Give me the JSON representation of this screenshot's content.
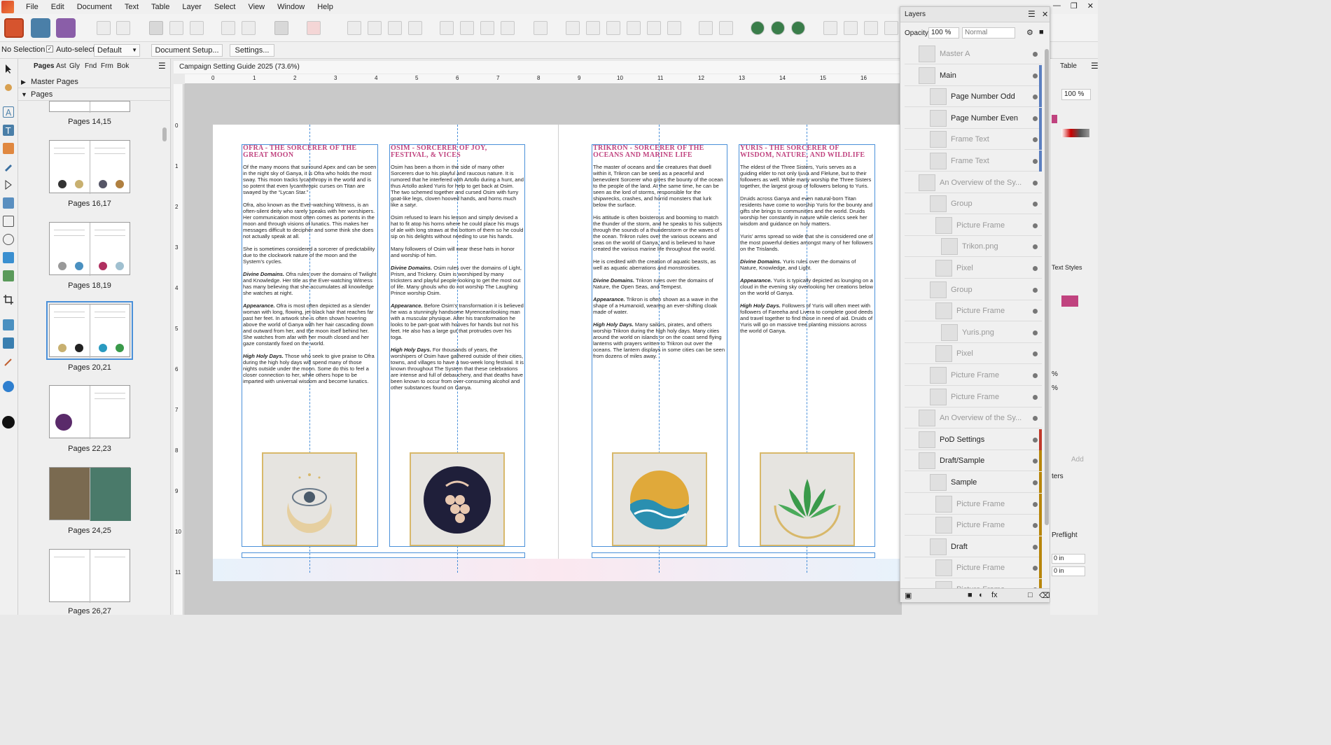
{
  "menu": [
    "File",
    "Edit",
    "Document",
    "Text",
    "Table",
    "Layer",
    "Select",
    "View",
    "Window",
    "Help"
  ],
  "context_bar": {
    "selection": "No Selection",
    "auto_select_label": "Auto-select:",
    "auto_select_value": "Default",
    "document_setup": "Document Setup...",
    "settings": "Settings..."
  },
  "pages_panel": {
    "tabs": [
      "Pages",
      "Ast",
      "Gly",
      "Fnd",
      "Frm",
      "Bok"
    ],
    "master_pages": "Master Pages",
    "pages": "Pages",
    "thumbnails": [
      "Pages 14,15",
      "Pages 16,17",
      "Pages 18,19",
      "Pages 20,21",
      "Pages 22,23",
      "Pages 24,25",
      "Pages 26,27"
    ]
  },
  "document": {
    "tab_title": "Campaign Setting Guide 2025 (73.6%)",
    "ruler_marks": [
      "0",
      "1",
      "2",
      "3",
      "4",
      "5",
      "6",
      "7",
      "8",
      "9",
      "10",
      "11",
      "12",
      "13",
      "14",
      "15",
      "16"
    ],
    "vruler_marks": [
      "0",
      "1",
      "2",
      "3",
      "4",
      "5",
      "6",
      "7",
      "8",
      "9",
      "10",
      "11"
    ],
    "columns": [
      {
        "title": "Ofra - The Sorcerer of the Great Moon",
        "paragraphs": [
          "Of the many moons that surround Apex and can be seen in the night sky of Ganya, it is Ofra who holds the most sway. This moon tracks lycanthropy in the world and is so potent that even lycanthropic curses on Titan are swayed by the “Lycan Star.”",
          "Ofra, also known as the Ever-watching Witness, is an often-silent deity who rarely speaks with her worshipers. Her communication most often comes as portents in the moon and through visions of lunatics. This makes her messages difficult to decipher and some think she does not actually speak at all.",
          "She is sometimes considered a sorcerer of predictability due to the clockwork nature of the moon and the System’s cycles.",
          "Divine Domains. Ofra rules over the domains of Twilight and Knowledge. Her title as the Ever-watching Witness has many believing that she accumulates all knowledge she watches at night.",
          "Appearance. Ofra is most often depicted as a slender woman with long, flowing, jet-black hair that reaches far past her feet. In artwork she is often shown hovering above the world of Ganya with her hair cascading down and outward from her, and the moon itself behind her. She watches from afar with her mouth closed and her gaze constantly fixed on the world.",
          "High Holy Days. Those who seek to give praise to Ofra during the high holy days will spend many of those nights outside under the moon. Some do this to feel a closer connection to her, while others hope to be imparted with universal wisdom and become lunatics."
        ]
      },
      {
        "title": "Osim - Sorcerer of Joy, Festival, & Vices",
        "paragraphs": [
          "Osim has been a thorn in the side of many other Sorcerers due to his playful and raucous nature. It is rumored that he interfered with Artollo during a hunt, and thus Artollo asked Yuris for help to get back at Osim. The two schemed together and cursed Osim with furry goat-like legs, cloven hooved hands, and horns much like a satyr.",
          "Osim refused to learn his lesson and simply devised a hat to fit atop his horns where he could place his mugs of ale with long straws at the bottom of them so he could sip on his delights without needing to use his hands.",
          "Many followers of Osim will wear these hats in honor and worship of him.",
          "Divine Domains. Osim rules over the domains of Light, Prism, and Trickery. Osim is worshiped by many tricksters and playful people looking to get the most out of life. Many ghouls who do not worship The Laughing Prince worship Osim.",
          "Appearance. Before Osim’s transformation it is believed he was a stunningly handsome Myrenceanlooking man with a muscular physique. After his transformation he looks to be part-goat with hooves for hands but not his feet. He also has a large gut that protrudes over his toga.",
          "High Holy Days. For thousands of years, the worshipers of Osim have gathered outside of their cities, towns, and villages to have a two-week long festival. It is known throughout The System that these celebrations are intense and full of debauchery, and that deaths have been known to occur from over-consuming alcohol and other substances found on Ganya."
        ]
      },
      {
        "title": "Trikron - Sorcerer of the Oceans and Marine Life",
        "paragraphs": [
          "The master of oceans and the creatures that dwell within it, Trikron can be seen as a peaceful and benevolent Sorcerer who gives the bounty of the ocean to the people of the land. At the same time, he can be seen as the lord of storms, responsible for the shipwrecks, crashes, and horrid monsters that lurk below the surface.",
          "His attitude is often boisterous and booming to match the thunder of the storm, and he speaks to his subjects through the sounds of a thunderstorm or the waves of the ocean. Trikron rules over the various oceans and seas on the world of Ganya, and is believed to have created the various marine life throughout the world.",
          "He is credited with the creation of aquatic beasts, as well as aquatic aberrations and monstrosities.",
          "Divine Domains. Trikron rules over the domains of Nature, the Open Seas, and Tempest.",
          "Appearance. Trikron is often shown as a wave in the shape of a Humanoid, wearing an ever-shifting cloak made of water.",
          "High Holy Days. Many sailors, pirates, and others worship Trikron during the high holy days. Many cities around the world on islands or on the coast send flying lanterns with prayers written to Trikron out over the oceans. The lantern displays in some cities can be seen from dozens of miles away."
        ]
      },
      {
        "title": "Yuris - The Sorcerer of Wisdom, Nature, and Wildlife",
        "paragraphs": [
          "The eldest of the Three Sisters, Yuris serves as a guiding elder to not only Ijuva and Flelune, but to their followers as well. While many worship the Three Sisters together, the largest group of followers belong to Yuris.",
          "Druids across Ganya and even natural-born Titan residents have come to worship Yuris for the bounty and gifts she brings to communities and the world. Druids worship her constantly in nature while clerics seek her wisdom and guidance on holy matters.",
          "Yuris’ arms spread so wide that she is considered one of the most powerful deities amongst many of her followers on the Trislands.",
          "Divine Domains. Yuris rules over the domains of Nature, Knowledge, and Light.",
          "Appearance. Yuris is typically depicted as lounging on a cloud in the evening sky overlooking her creations below on the world of Ganya.",
          "High Holy Days. Followers of Yuris will often meet with followers of Fareeha and Livera to complete good deeds and travel together to find those in need of aid. Druids of Yuris will go on massive tree planting missions across the world of Ganya."
        ]
      }
    ]
  },
  "layers_panel": {
    "title": "Layers",
    "opacity_label": "Opacity:",
    "opacity_value": "100 %",
    "blend_mode": "Normal",
    "rows": [
      {
        "name": "Master A",
        "dim": true,
        "color": ""
      },
      {
        "name": "Main",
        "dim": false,
        "color": "#5b7fc0"
      },
      {
        "name": "Page Number Odd",
        "dim": false,
        "color": "#5b7fc0"
      },
      {
        "name": "Page Number Even",
        "dim": false,
        "color": "#5b7fc0"
      },
      {
        "name": "Frame Text",
        "dim": true,
        "color": "#5b7fc0"
      },
      {
        "name": "Frame Text",
        "dim": true,
        "color": "#5b7fc0"
      },
      {
        "name": "An Overview of the Sy...",
        "dim": true,
        "color": ""
      },
      {
        "name": "Group",
        "dim": true,
        "color": ""
      },
      {
        "name": "Picture Frame",
        "dim": true,
        "color": ""
      },
      {
        "name": "Trikon.png",
        "dim": true,
        "color": ""
      },
      {
        "name": "Pixel",
        "dim": true,
        "color": ""
      },
      {
        "name": "Group",
        "dim": true,
        "color": ""
      },
      {
        "name": "Picture Frame",
        "dim": true,
        "color": ""
      },
      {
        "name": "Yuris.png",
        "dim": true,
        "color": ""
      },
      {
        "name": "Pixel",
        "dim": true,
        "color": ""
      },
      {
        "name": "Picture Frame",
        "dim": true,
        "color": ""
      },
      {
        "name": "Picture Frame",
        "dim": true,
        "color": ""
      },
      {
        "name": "An Overview of the Sy...",
        "dim": true,
        "color": ""
      },
      {
        "name": "PoD Settings",
        "dim": false,
        "color": "#c0392b"
      },
      {
        "name": "Draft/Sample",
        "dim": false,
        "color": "#b8860b"
      },
      {
        "name": "Sample",
        "dim": false,
        "color": "#b8860b"
      },
      {
        "name": "Picture Frame",
        "dim": true,
        "color": "#b8860b"
      },
      {
        "name": "Picture Frame",
        "dim": true,
        "color": "#b8860b"
      },
      {
        "name": "Draft",
        "dim": false,
        "color": "#b8860b"
      },
      {
        "name": "Picture Frame",
        "dim": true,
        "color": "#b8860b"
      },
      {
        "name": "Picture Frame",
        "dim": true,
        "color": "#b8860b"
      }
    ]
  },
  "right_panel": {
    "tab_table": "Table",
    "opacity_value": "100 %",
    "text_styles": "Text Styles",
    "preflight": "Preflight",
    "add": "Add",
    "field_1": "0 in",
    "field_2": "0 in",
    "pct_1": "%",
    "pct_2": "%",
    "ters": "ters"
  },
  "colors": {
    "accent": "#c0437f",
    "guide": "#4a90d9",
    "frame_gold": "#d8b86a"
  }
}
